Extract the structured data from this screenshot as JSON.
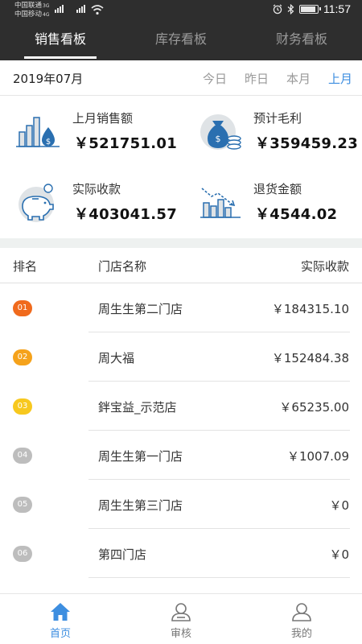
{
  "status_bar": {
    "carrier1": "中国联通",
    "carrier1_net": "3G",
    "carrier2": "中国移动",
    "carrier2_net": "4G",
    "time": "11:57"
  },
  "tabs": [
    {
      "label": "销售看板",
      "active": true
    },
    {
      "label": "库存看板",
      "active": false
    },
    {
      "label": "财务看板",
      "active": false
    }
  ],
  "period": {
    "month": "2019年07月",
    "options": [
      "今日",
      "昨日",
      "本月",
      "上月"
    ],
    "selected": "上月"
  },
  "metrics": [
    {
      "label": "上月销售额",
      "value": "￥521751.01",
      "icon": "bar-chart-money-icon"
    },
    {
      "label": "预计毛利",
      "value": "￥359459.23",
      "icon": "money-bag-icon"
    },
    {
      "label": "实际收款",
      "value": "￥403041.57",
      "icon": "piggy-bank-icon"
    },
    {
      "label": "退货金额",
      "value": "￥4544.02",
      "icon": "declining-chart-icon"
    }
  ],
  "table": {
    "headers": {
      "rank": "排名",
      "store": "门店名称",
      "amount": "实际收款"
    },
    "rows": [
      {
        "rank": "01",
        "store": "周生生第二门店",
        "amount": "￥184315.10",
        "color": "#f06a1d"
      },
      {
        "rank": "02",
        "store": "周大福",
        "amount": "￥152484.38",
        "color": "#f5a21b"
      },
      {
        "rank": "03",
        "store": "鉡宝益_示范店",
        "amount": "￥65235.00",
        "color": "#f7c81e"
      },
      {
        "rank": "04",
        "store": "周生生第一门店",
        "amount": "￥1007.09",
        "color": "#bdbdbd"
      },
      {
        "rank": "05",
        "store": "周生生第三门店",
        "amount": "￥0",
        "color": "#bdbdbd"
      },
      {
        "rank": "06",
        "store": "第四门店",
        "amount": "￥0",
        "color": "#bdbdbd"
      }
    ]
  },
  "bottom_nav": [
    {
      "label": "首页",
      "icon": "home-icon",
      "active": true
    },
    {
      "label": "审核",
      "icon": "reviewer-icon",
      "active": false
    },
    {
      "label": "我的",
      "icon": "profile-icon",
      "active": false
    }
  ],
  "colors": {
    "accent": "#3d8ee0",
    "header_bg": "#2e2e2e",
    "icon_blue": "#2a6fb0",
    "icon_fill": "#dfe3e6"
  }
}
